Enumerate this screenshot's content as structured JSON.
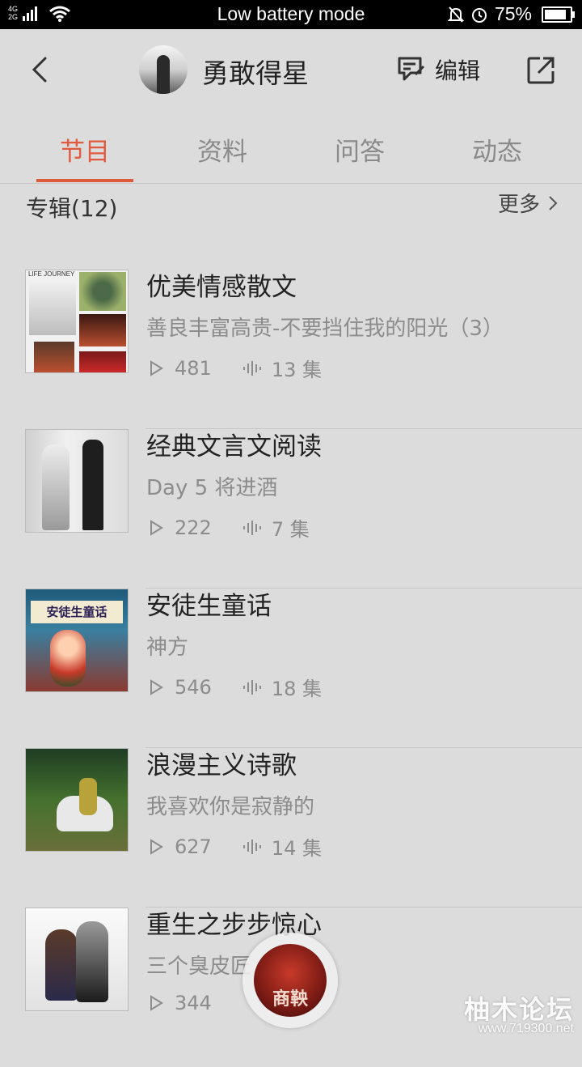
{
  "status_bar": {
    "network": "4G\n2G",
    "mode_text": "Low battery mode",
    "battery_percent": "75%",
    "battery_level": 0.75
  },
  "header": {
    "name": "勇敢得星",
    "edit_label": "编辑"
  },
  "tabs": [
    {
      "label": "节目",
      "active": true
    },
    {
      "label": "资料",
      "active": false
    },
    {
      "label": "问答",
      "active": false
    },
    {
      "label": "动态",
      "active": false
    }
  ],
  "section": {
    "title": "专辑(12)",
    "more_label": "更多"
  },
  "albums": [
    {
      "title": "优美情感散文",
      "subtitle": "善良丰富高贵-不要挡住我的阳光（3）",
      "plays": "481",
      "episodes": "13 集",
      "cover_text": "LIFE JOURNEY"
    },
    {
      "title": "经典文言文阅读",
      "subtitle": "Day 5 将进酒",
      "plays": "222",
      "episodes": "7 集"
    },
    {
      "title": "安徒生童话",
      "subtitle": "神方",
      "plays": "546",
      "episodes": "18 集",
      "cover_text": "安徒生童话"
    },
    {
      "title": "浪漫主义诗歌",
      "subtitle": "我喜欢你是寂静的",
      "plays": "627",
      "episodes": "14 集"
    },
    {
      "title": "重生之步步惊心",
      "subtitle": "三个臭皮匠",
      "plays": "344",
      "episodes": ""
    }
  ],
  "player": {
    "disc_text": "商鞅"
  },
  "watermark": {
    "main": "柚木论坛",
    "url": "www.719300.net"
  },
  "colors": {
    "accent": "#e25a3e",
    "background": "#dcdcdc"
  }
}
